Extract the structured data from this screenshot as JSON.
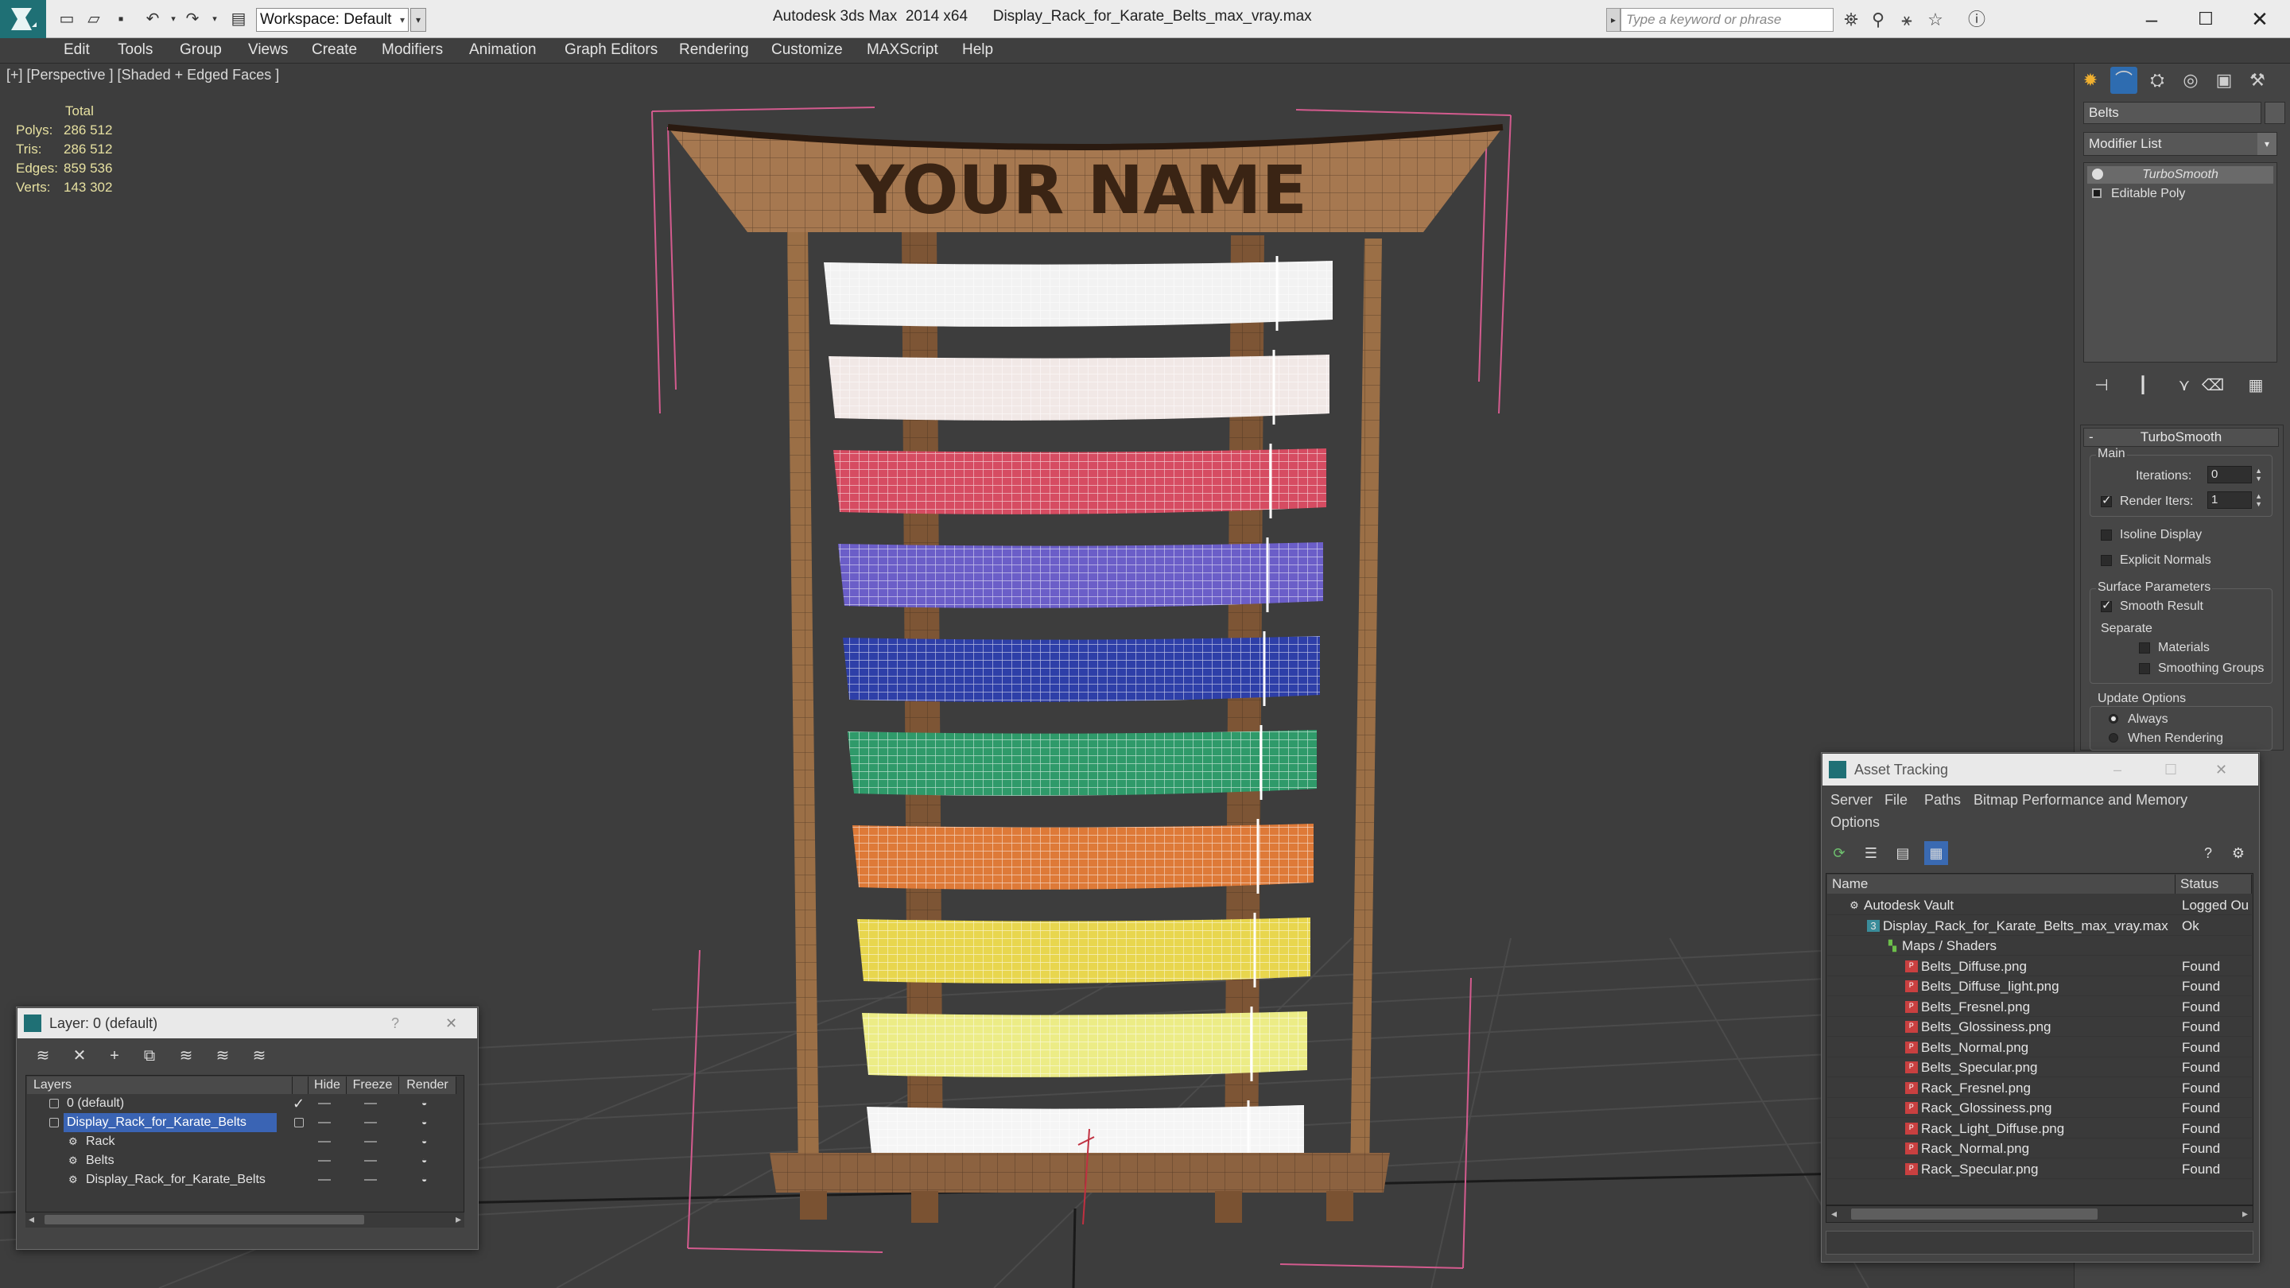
{
  "titlebar": {
    "workspace": "Workspace: Default",
    "app_title": "Autodesk 3ds Max  2014 x64",
    "file_title": "Display_Rack_for_Karate_Belts_max_vray.max",
    "search_placeholder": "Type a keyword or phrase"
  },
  "menu": [
    "Edit",
    "Tools",
    "Group",
    "Views",
    "Create",
    "Modifiers",
    "Animation",
    "Graph Editors",
    "Rendering",
    "Customize",
    "MAXScript",
    "Help"
  ],
  "viewport": {
    "label": "[+] [Perspective ] [Shaded + Edged Faces ]",
    "stats": {
      "header": "Total",
      "rows": [
        {
          "label": "Polys:",
          "value": "286 512"
        },
        {
          "label": "Tris:",
          "value": "286 512"
        },
        {
          "label": "Edges:",
          "value": "859 536"
        },
        {
          "label": "Verts:",
          "value": "143 302"
        }
      ]
    },
    "sign_text": "YOUR NAME",
    "belt_colors": [
      "#f2f2f2",
      "#f1e8e6",
      "#d64c62",
      "#6b5ec8",
      "#2e3fa8",
      "#2f9a6a",
      "#de7a38",
      "#e8d64e",
      "#ecec86",
      "#f5f5f5"
    ]
  },
  "command_panel": {
    "object_name": "Belts",
    "modifier_list": "Modifier List",
    "stack": [
      "TurboSmooth",
      "Editable Poly"
    ],
    "rollout": {
      "title": "TurboSmooth",
      "main_label": "Main",
      "iterations_label": "Iterations:",
      "iterations_value": "0",
      "render_iters_label": "Render Iters:",
      "render_iters_value": "1",
      "isoline": "Isoline Display",
      "explicit": "Explicit Normals",
      "surface_label": "Surface Parameters",
      "smooth_result": "Smooth Result",
      "separate_label": "Separate",
      "materials": "Materials",
      "smoothing_groups": "Smoothing Groups",
      "update_label": "Update Options",
      "always": "Always",
      "when_rendering": "When Rendering"
    }
  },
  "layer_window": {
    "title": "Layer: 0 (default)",
    "help": "?",
    "columns": {
      "layers": "Layers",
      "hide": "Hide",
      "freeze": "Freeze",
      "render": "Render"
    },
    "rows": [
      {
        "name": "0 (default)"
      },
      {
        "name": "Display_Rack_for_Karate_Belts"
      },
      {
        "name": "Rack"
      },
      {
        "name": "Belts"
      },
      {
        "name": "Display_Rack_for_Karate_Belts"
      }
    ]
  },
  "asset_tracking": {
    "title": "Asset Tracking",
    "menu": [
      "Server",
      "File",
      "Paths",
      "Bitmap Performance and Memory",
      "Options"
    ],
    "columns": {
      "name": "Name",
      "status": "Status"
    },
    "rows": [
      {
        "name": "Autodesk Vault",
        "status": "Logged Ou"
      },
      {
        "name": "Display_Rack_for_Karate_Belts_max_vray.max",
        "status": "Ok"
      },
      {
        "name": "Maps / Shaders",
        "status": ""
      },
      {
        "name": "Belts_Diffuse.png",
        "status": "Found"
      },
      {
        "name": "Belts_Diffuse_light.png",
        "status": "Found"
      },
      {
        "name": "Belts_Fresnel.png",
        "status": "Found"
      },
      {
        "name": "Belts_Glossiness.png",
        "status": "Found"
      },
      {
        "name": "Belts_Normal.png",
        "status": "Found"
      },
      {
        "name": "Belts_Specular.png",
        "status": "Found"
      },
      {
        "name": "Rack_Fresnel.png",
        "status": "Found"
      },
      {
        "name": "Rack_Glossiness.png",
        "status": "Found"
      },
      {
        "name": "Rack_Light_Diffuse.png",
        "status": "Found"
      },
      {
        "name": "Rack_Normal.png",
        "status": "Found"
      },
      {
        "name": "Rack_Specular.png",
        "status": "Found"
      }
    ]
  }
}
